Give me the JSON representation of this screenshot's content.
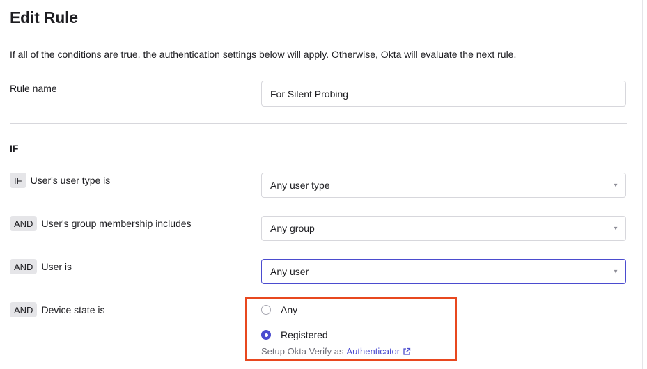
{
  "page": {
    "title": "Edit Rule",
    "description": "If all of the conditions are true, the authentication settings below will apply. Otherwise, Okta will evaluate the next rule."
  },
  "rule_name": {
    "label": "Rule name",
    "value": "For Silent Probing"
  },
  "section": {
    "if_heading": "IF"
  },
  "conditions": [
    {
      "operator": "IF",
      "label": "User's user type is",
      "value": "Any user type",
      "focused": false
    },
    {
      "operator": "AND",
      "label": "User's group membership includes",
      "value": "Any group",
      "focused": false
    },
    {
      "operator": "AND",
      "label": "User is",
      "value": "Any user",
      "focused": true
    }
  ],
  "device_state": {
    "operator": "AND",
    "label": "Device state is",
    "options": [
      {
        "label": "Any",
        "selected": false
      },
      {
        "label": "Registered",
        "selected": true
      }
    ],
    "helper_text": "Setup Okta Verify as",
    "helper_link": "Authenticator",
    "link_icon": "external-link-icon"
  },
  "colors": {
    "accent": "#4b4ccf",
    "highlight_border": "#e8481f",
    "pill_bg": "#e5e5e8"
  }
}
